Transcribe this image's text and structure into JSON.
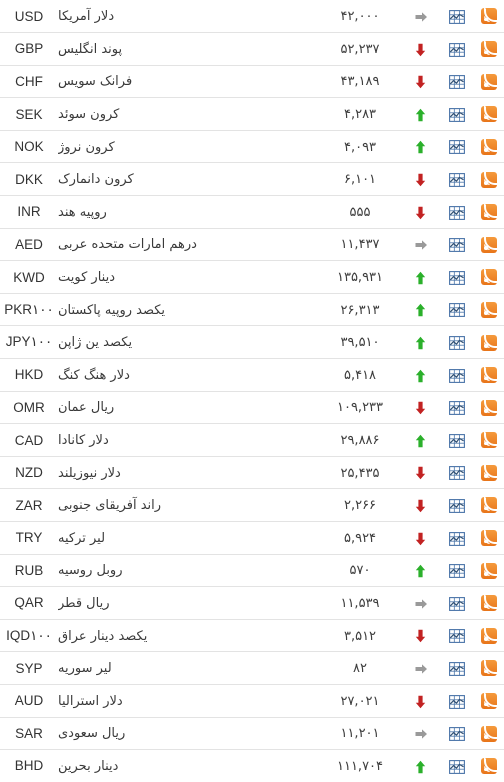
{
  "page": {
    "direction": "rtl",
    "background_color": "#ffffff",
    "row_separator_color": "#e3e3e3"
  },
  "icons": {
    "rss": {
      "name": "rss-feed-icon",
      "color": "#e8751a"
    },
    "chart": {
      "name": "chart-icon",
      "color": "#4a74a8"
    },
    "trend_up": {
      "name": "arrow-up-icon",
      "color": "#2bb02b"
    },
    "trend_down": {
      "name": "arrow-down-icon",
      "color": "#c22222"
    },
    "trend_flat": {
      "name": "arrow-right-icon",
      "color": "#9a9a9a"
    }
  },
  "columns": {
    "rss": "rss",
    "chart": "chart",
    "trend": "trend",
    "value": "value",
    "name": "name",
    "code": "code"
  },
  "rows": [
    {
      "code": "USD",
      "name": "دلار آمریکا",
      "value": "۴۲,۰۰۰",
      "trend": "flat"
    },
    {
      "code": "GBP",
      "name": "پوند انگلیس",
      "value": "۵۲,۲۳۷",
      "trend": "down"
    },
    {
      "code": "CHF",
      "name": "فرانک سویس",
      "value": "۴۳,۱۸۹",
      "trend": "down"
    },
    {
      "code": "SEK",
      "name": "کرون سوئد",
      "value": "۴,۲۸۳",
      "trend": "up"
    },
    {
      "code": "NOK",
      "name": "کرون نروژ",
      "value": "۴,۰۹۳",
      "trend": "up"
    },
    {
      "code": "DKK",
      "name": "کرون دانمارک",
      "value": "۶,۱۰۱",
      "trend": "down"
    },
    {
      "code": "INR",
      "name": "روپیه هند",
      "value": "۵۵۵",
      "trend": "down"
    },
    {
      "code": "AED",
      "name": "درهم امارات متحده عربی",
      "value": "۱۱,۴۳۷",
      "trend": "flat"
    },
    {
      "code": "KWD",
      "name": "دینار کویت",
      "value": "۱۳۵,۹۳۱",
      "trend": "up"
    },
    {
      "code": "PKR۱۰۰",
      "name": "یکصد روپیه پاکستان",
      "value": "۲۶,۳۱۳",
      "trend": "up"
    },
    {
      "code": "JPY۱۰۰",
      "name": "یکصد ین ژاپن",
      "value": "۳۹,۵۱۰",
      "trend": "up"
    },
    {
      "code": "HKD",
      "name": "دلار هنگ کنگ",
      "value": "۵,۴۱۸",
      "trend": "up"
    },
    {
      "code": "OMR",
      "name": "ریال عمان",
      "value": "۱۰۹,۲۳۳",
      "trend": "down"
    },
    {
      "code": "CAD",
      "name": "دلار کانادا",
      "value": "۲۹,۸۸۶",
      "trend": "up"
    },
    {
      "code": "NZD",
      "name": "دلار نیوزیلند",
      "value": "۲۵,۴۳۵",
      "trend": "down"
    },
    {
      "code": "ZAR",
      "name": "راند آفریقای جنوبی",
      "value": "۲,۲۶۶",
      "trend": "down"
    },
    {
      "code": "TRY",
      "name": "لیر ترکیه",
      "value": "۵,۹۲۴",
      "trend": "down"
    },
    {
      "code": "RUB",
      "name": "روبل روسیه",
      "value": "۵۷۰",
      "trend": "up"
    },
    {
      "code": "QAR",
      "name": "ریال قطر",
      "value": "۱۱,۵۳۹",
      "trend": "flat"
    },
    {
      "code": "IQD۱۰۰",
      "name": "یکصد دینار عراق",
      "value": "۳,۵۱۲",
      "trend": "down"
    },
    {
      "code": "SYP",
      "name": "لیر سوریه",
      "value": "۸۲",
      "trend": "flat"
    },
    {
      "code": "AUD",
      "name": "دلار استرالیا",
      "value": "۲۷,۰۲۱",
      "trend": "down"
    },
    {
      "code": "SAR",
      "name": "ریال سعودی",
      "value": "۱۱,۲۰۱",
      "trend": "flat"
    },
    {
      "code": "BHD",
      "name": "دینار بحرین",
      "value": "۱۱۱,۷۰۴",
      "trend": "up"
    }
  ]
}
